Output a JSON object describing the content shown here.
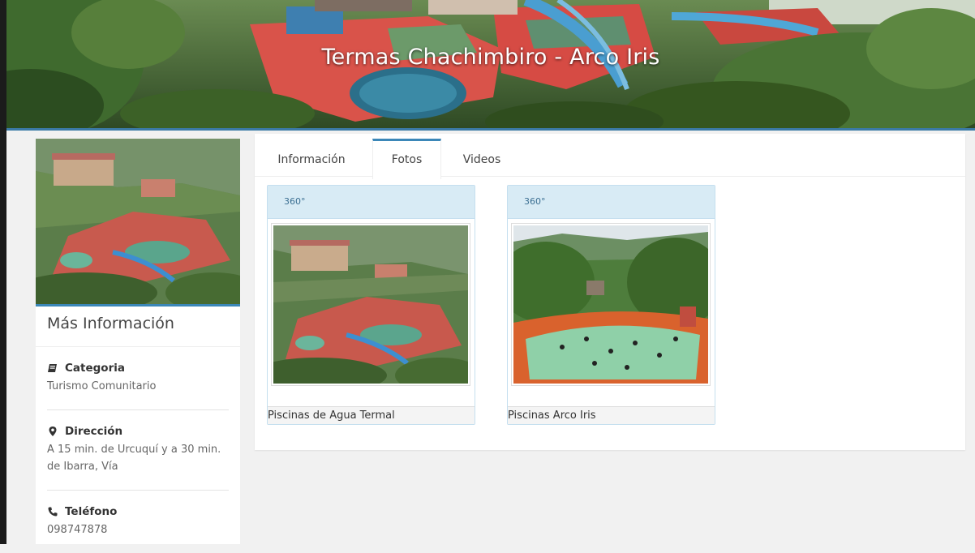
{
  "banner": {
    "title": "Termas Chachimbiro - Arco Iris"
  },
  "sidebar": {
    "heading": "Más Información",
    "items": [
      {
        "icon": "book-icon",
        "title": "Categoria",
        "value": "Turismo Comunitario"
      },
      {
        "icon": "map-marker-icon",
        "title": "Dirección",
        "value": "A 15 min. de Urcuquí y a 30 min. de Ibarra, Vía"
      },
      {
        "icon": "phone-icon",
        "title": "Teléfono",
        "value": "098747878"
      }
    ]
  },
  "tabs": [
    {
      "label": "Información",
      "active": false
    },
    {
      "label": "Fotos",
      "active": true
    },
    {
      "label": "Videos",
      "active": false
    }
  ],
  "photos": [
    {
      "badge": "360°",
      "caption": "Piscinas de Agua Termal"
    },
    {
      "badge": "360°",
      "caption": "Piscinas Arco Iris"
    }
  ],
  "colors": {
    "accent": "#3b87b8",
    "card_header": "#d8ebf5",
    "page_background": "#f1f1f1"
  }
}
